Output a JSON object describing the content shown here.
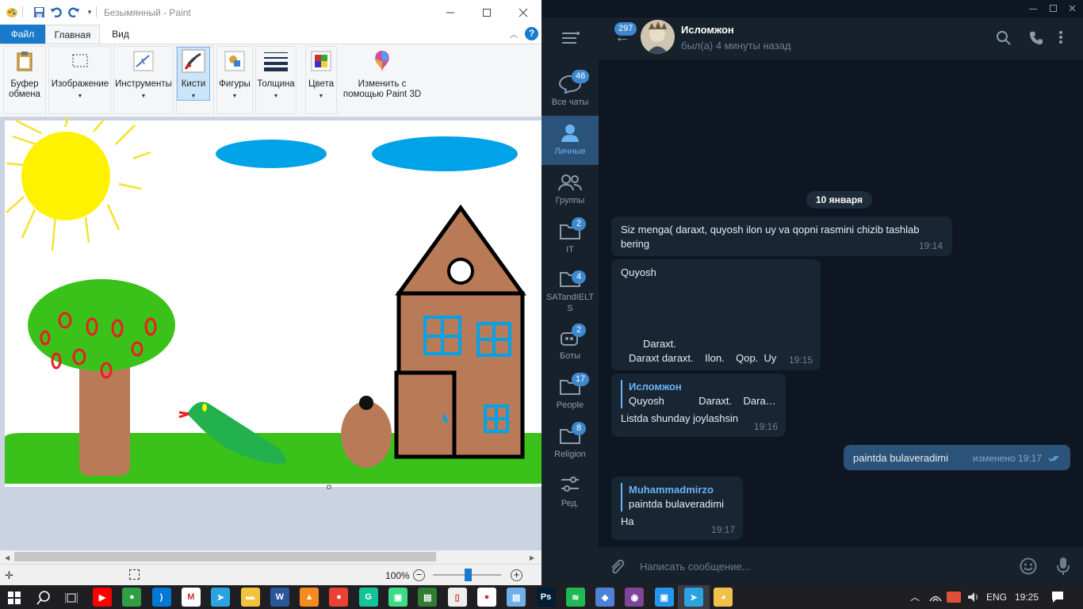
{
  "paint": {
    "title": "Безымянный - Paint",
    "tabs": {
      "file": "Файл",
      "home": "Главная",
      "view": "Вид"
    },
    "ribbon": {
      "clipboard": "Буфер обмена",
      "image": "Изображение",
      "tools": "Инструменты",
      "brushes": "Кисти",
      "shapes": "Фигуры",
      "size": "Толщина",
      "colors": "Цвета",
      "paint3d": "Изменить с помощью Paint 3D"
    },
    "status": {
      "zoom": "100%"
    }
  },
  "telegram": {
    "contact": {
      "name": "Исломжон",
      "status": "был(а) 4 минуты назад",
      "unread_back": "297"
    },
    "folders": [
      {
        "label": "Все чаты",
        "badge": "46",
        "icon": "chat-bubble-icon"
      },
      {
        "label": "Личные",
        "badge": "",
        "icon": "person-icon"
      },
      {
        "label": "Группы",
        "badge": "",
        "icon": "group-icon"
      },
      {
        "label": "IT",
        "badge": "2",
        "icon": "folder-icon"
      },
      {
        "label": "SATandIELTS",
        "badge": "4",
        "icon": "folder-icon"
      },
      {
        "label": "Боты",
        "badge": "2",
        "icon": "bot-icon"
      },
      {
        "label": "People",
        "badge": "17",
        "icon": "folder-icon"
      },
      {
        "label": "Religion",
        "badge": "8",
        "icon": "folder-icon"
      },
      {
        "label": "Ред.",
        "badge": "",
        "icon": "edit-filters-icon"
      }
    ],
    "date_divider": "10 января",
    "messages": {
      "m1": {
        "text": "Siz menga( daraxt, quyosh ilon uy va qopni rasmini chizib tashlab bering",
        "time": "19:14"
      },
      "m2": {
        "line1": "Quyosh",
        "line2": "Daraxt.",
        "line3": "Daraxt daraxt.    Ilon.    Qop.  Uy",
        "time": "19:15"
      },
      "m3": {
        "reply_name": "Исломжон",
        "reply_text": "Quyosh            Daraxt.    Dara…",
        "text": "Listda shunday joylashsin",
        "time": "19:16"
      },
      "m4": {
        "text": "paintda  bulaveradimi",
        "edited": "изменено",
        "time": "19:17"
      },
      "m5": {
        "reply_name": "Muhammadmirzo",
        "reply_text": "paintda  bulaveradimi",
        "text": "На",
        "time": "19:17"
      }
    },
    "input_placeholder": "Написать сообщение..."
  },
  "taskbar": {
    "lang": "ENG",
    "time": "19:25",
    "apps": [
      "youtube-icon",
      "chrome-icon",
      "vscode-icon",
      "gmail-icon",
      "telegram-icon",
      "explorer-icon",
      "word-icon",
      "vlc-icon",
      "maps-icon",
      "grammarly-icon",
      "android-icon",
      "terminal-icon",
      "file-icon",
      "record-icon",
      "notepad-icon",
      "photoshop-icon",
      "spotify-icon",
      "bluestacks-icon",
      "tor-icon",
      "docker-icon",
      "telegram-active-icon",
      "paint-icon"
    ]
  },
  "colors": {
    "tg_bg": "#0e1621",
    "tg_panel": "#17212b",
    "tg_accent": "#6ab3f3",
    "paint_file_tab": "#1979ca"
  }
}
